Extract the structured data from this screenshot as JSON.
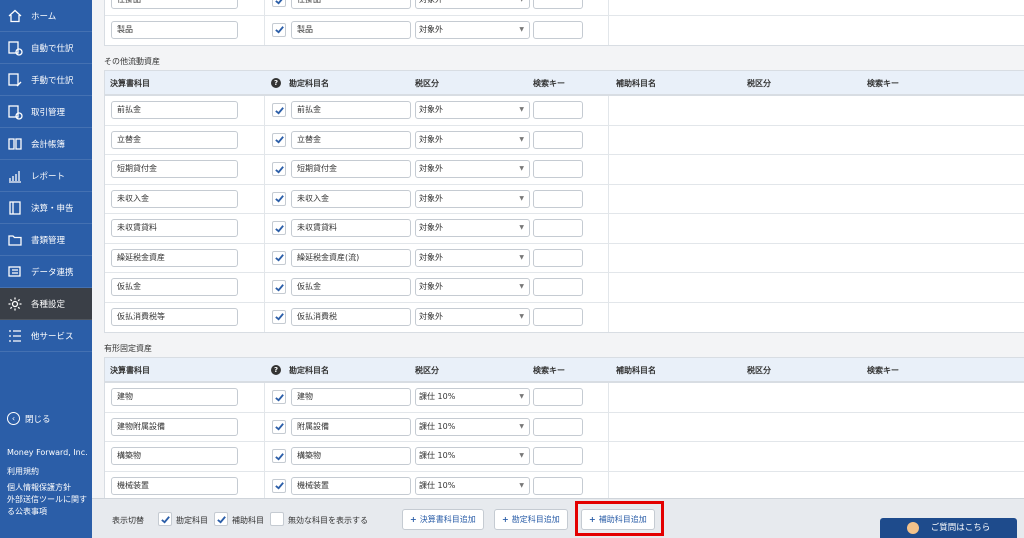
{
  "sidebar": {
    "items": [
      {
        "label": "ホーム",
        "icon": "home-icon"
      },
      {
        "label": "自動で仕訳",
        "icon": "auto-journal-icon"
      },
      {
        "label": "手動で仕訳",
        "icon": "manual-journal-icon"
      },
      {
        "label": "取引管理",
        "icon": "transaction-icon"
      },
      {
        "label": "会計帳簿",
        "icon": "ledger-icon"
      },
      {
        "label": "レポート",
        "icon": "report-icon"
      },
      {
        "label": "決算・申告",
        "icon": "settlement-icon"
      },
      {
        "label": "書類管理",
        "icon": "folder-icon"
      },
      {
        "label": "データ連携",
        "icon": "data-link-icon"
      },
      {
        "label": "各種設定",
        "icon": "gear-icon"
      },
      {
        "label": "他サービス",
        "icon": "list-icon"
      }
    ],
    "active_index": 9,
    "close_label": "閉じる",
    "company": "Money Forward, Inc.",
    "links": [
      "利用規約",
      "個人情報保護方針",
      "外部送信ツールに関する公表事項"
    ]
  },
  "top_rows": [
    {
      "statement": "仕掛品",
      "account": "仕掛品",
      "tax": "対象外"
    },
    {
      "statement": "製品",
      "account": "製品",
      "tax": "対象外"
    }
  ],
  "headers": {
    "statement": "決算書科目",
    "account": "勘定科目名",
    "tax": "税区分",
    "search": "検索キー",
    "sub_account": "補助科目名",
    "sub_tax": "税区分",
    "sub_search": "検索キー"
  },
  "sections": [
    {
      "title": "その他流動資産",
      "rows": [
        {
          "statement": "前払金",
          "account": "前払金",
          "tax": "対象外"
        },
        {
          "statement": "立替金",
          "account": "立替金",
          "tax": "対象外"
        },
        {
          "statement": "短期貸付金",
          "account": "短期貸付金",
          "tax": "対象外"
        },
        {
          "statement": "未収入金",
          "account": "未収入金",
          "tax": "対象外"
        },
        {
          "statement": "未収賃貸料",
          "account": "未収賃貸料",
          "tax": "対象外"
        },
        {
          "statement": "繰延税金資産",
          "account": "繰延税金資産(流)",
          "tax": "対象外"
        },
        {
          "statement": "仮払金",
          "account": "仮払金",
          "tax": "対象外"
        },
        {
          "statement": "仮払消費税等",
          "account": "仮払消費税",
          "tax": "対象外"
        }
      ]
    },
    {
      "title": "有形固定資産",
      "rows": [
        {
          "statement": "建物",
          "account": "建物",
          "tax": "課仕 10%"
        },
        {
          "statement": "建物附属設備",
          "account": "附属設備",
          "tax": "課仕 10%"
        },
        {
          "statement": "構築物",
          "account": "構築物",
          "tax": "課仕 10%"
        },
        {
          "statement": "機械装置",
          "account": "機械装置",
          "tax": "課仕 10%"
        }
      ]
    }
  ],
  "bottombar": {
    "label": "表示切替",
    "check_account": "勘定科目",
    "check_sub": "補助科目",
    "check_invalid": "無効な科目を表示する",
    "btn_statement": "決算書科目追加",
    "btn_account": "勘定科目追加",
    "btn_sub": "補助科目追加",
    "plus": "+"
  },
  "question": "ご質問はこちら",
  "colors": {
    "sidebar": "#2b5ea8",
    "active": "#3a3f47",
    "highlight": "#e30000",
    "header_bg": "#e9f0f9"
  }
}
